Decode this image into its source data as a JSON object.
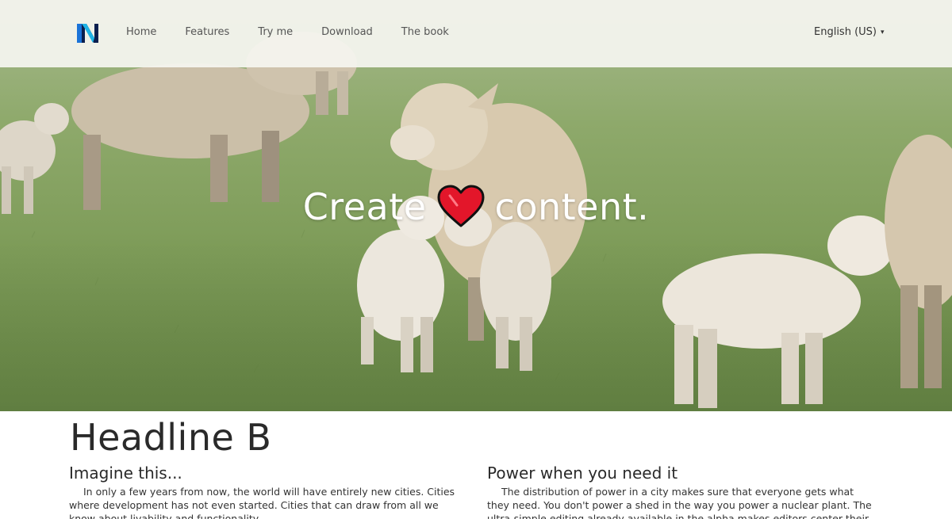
{
  "nav": {
    "logo_letter": "N",
    "links": [
      "Home",
      "Features",
      "Try me",
      "Download",
      "The book"
    ],
    "language": "English (US)",
    "caret": "▾"
  },
  "hero": {
    "title_before": "Create",
    "title_after": "content.",
    "heart_icon": "heart-icon",
    "background": "sheep-and-lambs-on-grass-photo"
  },
  "main": {
    "headline": "Headline B",
    "columns": [
      {
        "title": "Imagine this...",
        "text": "In only a few years from now, the world will have entirely new cities. Cities where development has not even started. Cities that can draw from all we know about livability and functionality."
      },
      {
        "title": "Power when you need it",
        "text": "The distribution of power in a city makes sure that everyone gets what they need. You don't power a shed in the way you power a nuclear plant. The ultra-simple editing already available in the alpha makes editors center their"
      }
    ]
  },
  "colors": {
    "accent_blue": "#1a73d8",
    "heart_red": "#e3162a",
    "grass": "#7e9c59"
  }
}
